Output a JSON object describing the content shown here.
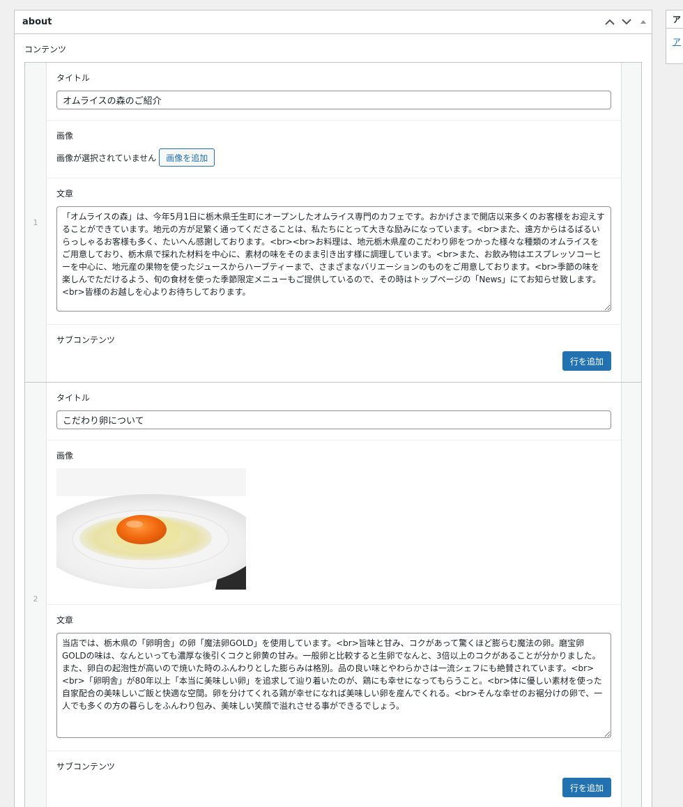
{
  "postbox": {
    "title": "about"
  },
  "field": {
    "label": "コンテンツ"
  },
  "rows": [
    {
      "index": "1",
      "title_label": "タイトル",
      "title_value": "オムライスの森のご紹介",
      "image_label": "画像",
      "image_empty_text": "画像が選択されていません",
      "image_add_button": "画像を追加",
      "text_label": "文章",
      "text_value": "「オムライスの森」は、今年5月1日に栃木県壬生町にオープンしたオムライス専門のカフェです。おかげさまで開店以来多くのお客様をお迎えすることができています。地元の方が足繁く通ってくださることは、私たちにとって大きな励みになっています。<br>また、遠方からはるばるいらっしゃるお客様も多く、たいへん感謝しております。<br><br>お料理は、地元栃木県産のこだわり卵をつかった様々な種類のオムライスをご用意しており、栃木県で採れた材料を中心に、素材の味をそのまま引き出す様に調理しています。<br>また、お飲み物はエスプレッソコーヒーを中心に、地元産の果物を使ったジュースからハーブティーまで、さまざまなバリエーションのものをご用意しております。<br>季節の味を楽しんでただけるよう、旬の食材を使った季節限定メニューもご提供しているので、その時はトップページの「News」にてお知らせ致します。<br>皆様のお越しを心よりお待ちしております。",
      "sub_label": "サブコンテンツ",
      "add_row_button": "行を追加"
    },
    {
      "index": "2",
      "title_label": "タイトル",
      "title_value": "こだわり卵について",
      "image_label": "画像",
      "text_label": "文章",
      "text_value": "当店では、栃木県の「卵明舎」の卵「魔法卵GOLD」を使用しています。<br>旨味と甘み、コクがあって驚くほど膨らむ魔法の卵。磨宝卵GOLDの味は、なんといっても濃厚な後引くコクと卵黄の甘み。一般卵と比較すると生卵でなんと、3倍以上のコクがあることが分かりました。また、卵白の起泡性が高いので焼いた時のふんわりとした膨らみは格別。品の良い味とやわらかさは一流シェフにも絶賛されています。<br><br>「卵明舎」が80年以上「本当に美味しい卵」を追求して辿り着いたのが、鶏にも幸せになってもらうこと。<br>体に優しい素材を使った自家配合の美味しいご飯と快適な空間。卵を分けてくれる鶏が幸せになれば美味しい卵を産んでくれる。<br>そんな幸せのお裾分けの卵で、一人でも多くの方の暮らしをふんわり包み、美味しい笑顔で溢れさせる事ができるでしょう。",
      "sub_label": "サブコンテンツ",
      "add_row_button": "行を追加"
    }
  ],
  "side_panel": {
    "title": "ア",
    "link": "ア"
  },
  "colors": {
    "accent": "#2271b1",
    "border": "#c3c4c7",
    "background": "#f0f0f1"
  }
}
